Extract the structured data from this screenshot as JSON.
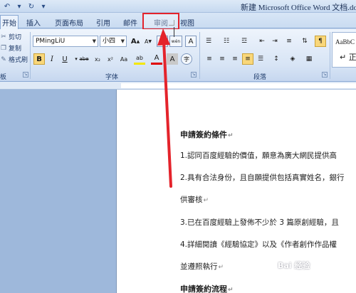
{
  "titlebar": {
    "title": "新建 Microsoft Office Word 文档.doc",
    "qat_icons": [
      "undo-icon",
      "redo-icon"
    ]
  },
  "tabs": [
    {
      "id": "home",
      "label": "开始",
      "active": true
    },
    {
      "id": "insert",
      "label": "插入",
      "active": false
    },
    {
      "id": "layout",
      "label": "页面布局",
      "active": false
    },
    {
      "id": "references",
      "label": "引用",
      "active": false
    },
    {
      "id": "mailings",
      "label": "邮件",
      "active": false
    },
    {
      "id": "review",
      "label": "审阅",
      "active": false
    },
    {
      "id": "view",
      "label": "视图",
      "active": false
    }
  ],
  "clipboard": {
    "cut": "剪切",
    "copy": "复制",
    "format_painter": "格式刷",
    "group_label_fragment": "板"
  },
  "font": {
    "family": "PMingLiU",
    "size": "小四",
    "group_label": "字体",
    "grow_label": "A",
    "shrink_label": "A",
    "clear_label": "A",
    "phonetic_label": "wén",
    "border_label": "A",
    "bold": "B",
    "italic": "I",
    "underline": "U",
    "strike": "abe",
    "subscript": "x₂",
    "superscript": "x²",
    "aa": "Aa",
    "highlight": "ab",
    "color": "A",
    "shade": "A",
    "circle": "字"
  },
  "paragraph": {
    "group_label": "段落"
  },
  "styles": {
    "preview": "AaBbC",
    "name": "↵ 正"
  },
  "document": {
    "lines": [
      {
        "text": "申請簽約條件",
        "heading": true
      },
      {
        "text": "1.認同百度經驗的價值，願意為廣大網民提供高",
        "heading": false
      },
      {
        "text": "2.具有合法身份，且自願提供包括真實姓名，銀行",
        "heading": false
      },
      {
        "text": "供審核",
        "heading": false
      },
      {
        "text": "3.已在百度經驗上發佈不少於 3 篇原創經驗，且",
        "heading": false
      },
      {
        "text": "4.詳細閱讀《經驗協定》以及《作者創作作品權",
        "heading": false
      },
      {
        "text": "並遵照執行",
        "heading": false
      },
      {
        "text": "申請簽約流程",
        "heading": true
      }
    ],
    "paragraph_mark": "↵"
  },
  "watermark": "Bai 经验",
  "colors": {
    "highlight_box": "#e4232b",
    "arrow": "#e4232b"
  }
}
